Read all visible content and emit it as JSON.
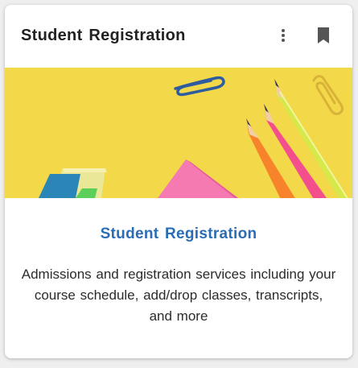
{
  "card": {
    "header_title": "Student Registration",
    "menu_icon": "more-vertical-icon",
    "bookmark_icon": "bookmark-icon",
    "link_title": "Student Registration",
    "description": "Admissions and registration services including your course schedule, add/drop classes, transcripts, and more"
  },
  "colors": {
    "link": "#2a6db5",
    "hero_background": "#f3d84a"
  }
}
